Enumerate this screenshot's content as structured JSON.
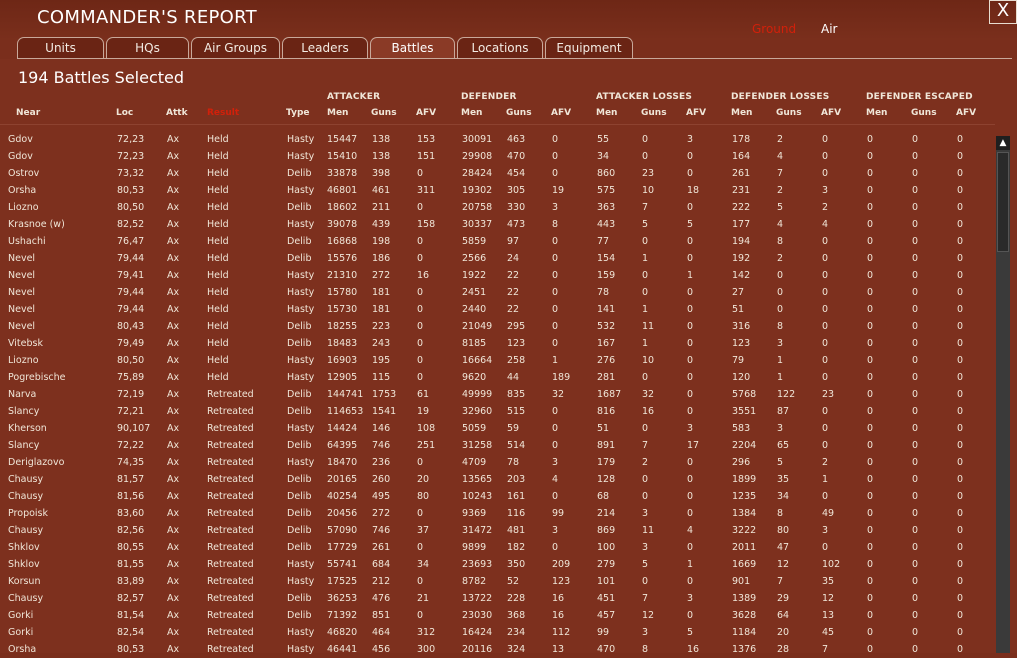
{
  "header": {
    "title": "COMMANDER'S REPORT",
    "mode_ground": "Ground",
    "mode_air": "Air",
    "close_label": "X"
  },
  "tabs": [
    {
      "label": "Units",
      "active": false
    },
    {
      "label": "HQs",
      "active": false
    },
    {
      "label": "Air Groups",
      "active": false
    },
    {
      "label": "Leaders",
      "active": false
    },
    {
      "label": "Battles",
      "active": true
    },
    {
      "label": "Locations",
      "active": false
    },
    {
      "label": "Equipment",
      "active": false
    }
  ],
  "summary": "194 Battles Selected",
  "group_headers": {
    "attacker": "ATTACKER",
    "defender": "DEFENDER",
    "attacker_losses": "ATTACKER LOSSES",
    "defender_losses": "DEFENDER LOSSES",
    "defender_escaped": "DEFENDER ESCAPED"
  },
  "columns": [
    "Near",
    "Loc",
    "Attk",
    "Result",
    "Type",
    "Men",
    "Guns",
    "AFV",
    "Men",
    "Guns",
    "AFV",
    "Men",
    "Guns",
    "AFV",
    "Men",
    "Guns",
    "AFV",
    "Men",
    "Guns",
    "AFV"
  ],
  "rows": [
    [
      "Gdov",
      "72,23",
      "Ax",
      "Held",
      "Hasty",
      "15447",
      "138",
      "153",
      "30091",
      "463",
      "0",
      "55",
      "0",
      "3",
      "178",
      "2",
      "0",
      "0",
      "0",
      "0"
    ],
    [
      "Gdov",
      "72,23",
      "Ax",
      "Held",
      "Hasty",
      "15410",
      "138",
      "151",
      "29908",
      "470",
      "0",
      "34",
      "0",
      "0",
      "164",
      "4",
      "0",
      "0",
      "0",
      "0"
    ],
    [
      "Ostrov",
      "73,32",
      "Ax",
      "Held",
      "Delib",
      "33878",
      "398",
      "0",
      "28424",
      "454",
      "0",
      "860",
      "23",
      "0",
      "261",
      "7",
      "0",
      "0",
      "0",
      "0"
    ],
    [
      "Orsha",
      "80,53",
      "Ax",
      "Held",
      "Hasty",
      "46801",
      "461",
      "311",
      "19302",
      "305",
      "19",
      "575",
      "10",
      "18",
      "231",
      "2",
      "3",
      "0",
      "0",
      "0"
    ],
    [
      "Liozno",
      "80,50",
      "Ax",
      "Held",
      "Delib",
      "18602",
      "211",
      "0",
      "20758",
      "330",
      "3",
      "363",
      "7",
      "0",
      "222",
      "5",
      "2",
      "0",
      "0",
      "0"
    ],
    [
      "Krasnoe (w)",
      "82,52",
      "Ax",
      "Held",
      "Hasty",
      "39078",
      "439",
      "158",
      "30337",
      "473",
      "8",
      "443",
      "5",
      "5",
      "177",
      "4",
      "4",
      "0",
      "0",
      "0"
    ],
    [
      "Ushachi",
      "76,47",
      "Ax",
      "Held",
      "Delib",
      "16868",
      "198",
      "0",
      "5859",
      "97",
      "0",
      "77",
      "0",
      "0",
      "194",
      "8",
      "0",
      "0",
      "0",
      "0"
    ],
    [
      "Nevel",
      "79,44",
      "Ax",
      "Held",
      "Delib",
      "15576",
      "186",
      "0",
      "2566",
      "24",
      "0",
      "154",
      "1",
      "0",
      "192",
      "2",
      "0",
      "0",
      "0",
      "0"
    ],
    [
      "Nevel",
      "79,41",
      "Ax",
      "Held",
      "Hasty",
      "21310",
      "272",
      "16",
      "1922",
      "22",
      "0",
      "159",
      "0",
      "1",
      "142",
      "0",
      "0",
      "0",
      "0",
      "0"
    ],
    [
      "Nevel",
      "79,44",
      "Ax",
      "Held",
      "Hasty",
      "15780",
      "181",
      "0",
      "2451",
      "22",
      "0",
      "78",
      "0",
      "0",
      "27",
      "0",
      "0",
      "0",
      "0",
      "0"
    ],
    [
      "Nevel",
      "79,44",
      "Ax",
      "Held",
      "Hasty",
      "15730",
      "181",
      "0",
      "2440",
      "22",
      "0",
      "141",
      "1",
      "0",
      "51",
      "0",
      "0",
      "0",
      "0",
      "0"
    ],
    [
      "Nevel",
      "80,43",
      "Ax",
      "Held",
      "Delib",
      "18255",
      "223",
      "0",
      "21049",
      "295",
      "0",
      "532",
      "11",
      "0",
      "316",
      "8",
      "0",
      "0",
      "0",
      "0"
    ],
    [
      "Vitebsk",
      "79,49",
      "Ax",
      "Held",
      "Delib",
      "18483",
      "243",
      "0",
      "8185",
      "123",
      "0",
      "167",
      "1",
      "0",
      "123",
      "3",
      "0",
      "0",
      "0",
      "0"
    ],
    [
      "Liozno",
      "80,50",
      "Ax",
      "Held",
      "Hasty",
      "16903",
      "195",
      "0",
      "16664",
      "258",
      "1",
      "276",
      "10",
      "0",
      "79",
      "1",
      "0",
      "0",
      "0",
      "0"
    ],
    [
      "Pogrebische",
      "75,89",
      "Ax",
      "Held",
      "Hasty",
      "12905",
      "115",
      "0",
      "9620",
      "44",
      "189",
      "281",
      "0",
      "0",
      "120",
      "1",
      "0",
      "0",
      "0",
      "0"
    ],
    [
      "Narva",
      "72,19",
      "Ax",
      "Retreated",
      "Delib",
      "144741",
      "1753",
      "61",
      "49999",
      "835",
      "32",
      "1687",
      "32",
      "0",
      "5768",
      "122",
      "23",
      "0",
      "0",
      "0"
    ],
    [
      "Slancy",
      "72,21",
      "Ax",
      "Retreated",
      "Delib",
      "114653",
      "1541",
      "19",
      "32960",
      "515",
      "0",
      "816",
      "16",
      "0",
      "3551",
      "87",
      "0",
      "0",
      "0",
      "0"
    ],
    [
      "Kherson",
      "90,107",
      "Ax",
      "Retreated",
      "Hasty",
      "14424",
      "146",
      "108",
      "5059",
      "59",
      "0",
      "51",
      "0",
      "3",
      "583",
      "3",
      "0",
      "0",
      "0",
      "0"
    ],
    [
      "Slancy",
      "72,22",
      "Ax",
      "Retreated",
      "Delib",
      "64395",
      "746",
      "251",
      "31258",
      "514",
      "0",
      "891",
      "7",
      "17",
      "2204",
      "65",
      "0",
      "0",
      "0",
      "0"
    ],
    [
      "Deriglazovo",
      "74,35",
      "Ax",
      "Retreated",
      "Hasty",
      "18470",
      "236",
      "0",
      "4709",
      "78",
      "3",
      "179",
      "2",
      "0",
      "296",
      "5",
      "2",
      "0",
      "0",
      "0"
    ],
    [
      "Chausy",
      "81,57",
      "Ax",
      "Retreated",
      "Delib",
      "20165",
      "260",
      "20",
      "13565",
      "203",
      "4",
      "128",
      "0",
      "0",
      "1899",
      "35",
      "1",
      "0",
      "0",
      "0"
    ],
    [
      "Chausy",
      "81,56",
      "Ax",
      "Retreated",
      "Delib",
      "40254",
      "495",
      "80",
      "10243",
      "161",
      "0",
      "68",
      "0",
      "0",
      "1235",
      "34",
      "0",
      "0",
      "0",
      "0"
    ],
    [
      "Propoisk",
      "83,60",
      "Ax",
      "Retreated",
      "Delib",
      "20456",
      "272",
      "0",
      "9369",
      "116",
      "99",
      "214",
      "3",
      "0",
      "1384",
      "8",
      "49",
      "0",
      "0",
      "0"
    ],
    [
      "Chausy",
      "82,56",
      "Ax",
      "Retreated",
      "Delib",
      "57090",
      "746",
      "37",
      "31472",
      "481",
      "3",
      "869",
      "11",
      "4",
      "3222",
      "80",
      "3",
      "0",
      "0",
      "0"
    ],
    [
      "Shklov",
      "80,55",
      "Ax",
      "Retreated",
      "Delib",
      "17729",
      "261",
      "0",
      "9899",
      "182",
      "0",
      "100",
      "3",
      "0",
      "2011",
      "47",
      "0",
      "0",
      "0",
      "0"
    ],
    [
      "Shklov",
      "81,55",
      "Ax",
      "Retreated",
      "Hasty",
      "55741",
      "684",
      "34",
      "23693",
      "350",
      "209",
      "279",
      "5",
      "1",
      "1669",
      "12",
      "102",
      "0",
      "0",
      "0"
    ],
    [
      "Korsun",
      "83,89",
      "Ax",
      "Retreated",
      "Hasty",
      "17525",
      "212",
      "0",
      "8782",
      "52",
      "123",
      "101",
      "0",
      "0",
      "901",
      "7",
      "35",
      "0",
      "0",
      "0"
    ],
    [
      "Chausy",
      "82,57",
      "Ax",
      "Retreated",
      "Delib",
      "36253",
      "476",
      "21",
      "13722",
      "228",
      "16",
      "451",
      "7",
      "3",
      "1389",
      "29",
      "12",
      "0",
      "0",
      "0"
    ],
    [
      "Gorki",
      "81,54",
      "Ax",
      "Retreated",
      "Delib",
      "71392",
      "851",
      "0",
      "23030",
      "368",
      "16",
      "457",
      "12",
      "0",
      "3628",
      "64",
      "13",
      "0",
      "0",
      "0"
    ],
    [
      "Gorki",
      "82,54",
      "Ax",
      "Retreated",
      "Hasty",
      "46820",
      "464",
      "312",
      "16424",
      "234",
      "112",
      "99",
      "3",
      "5",
      "1184",
      "20",
      "45",
      "0",
      "0",
      "0"
    ],
    [
      "Orsha",
      "80,53",
      "Ax",
      "Retreated",
      "Hasty",
      "46441",
      "456",
      "300",
      "20116",
      "324",
      "13",
      "470",
      "8",
      "16",
      "1376",
      "28",
      "7",
      "0",
      "0",
      "0"
    ]
  ],
  "colors": {
    "background": "#7d301e",
    "accent_red": "#d2200a",
    "text": "#f0e6d8"
  }
}
